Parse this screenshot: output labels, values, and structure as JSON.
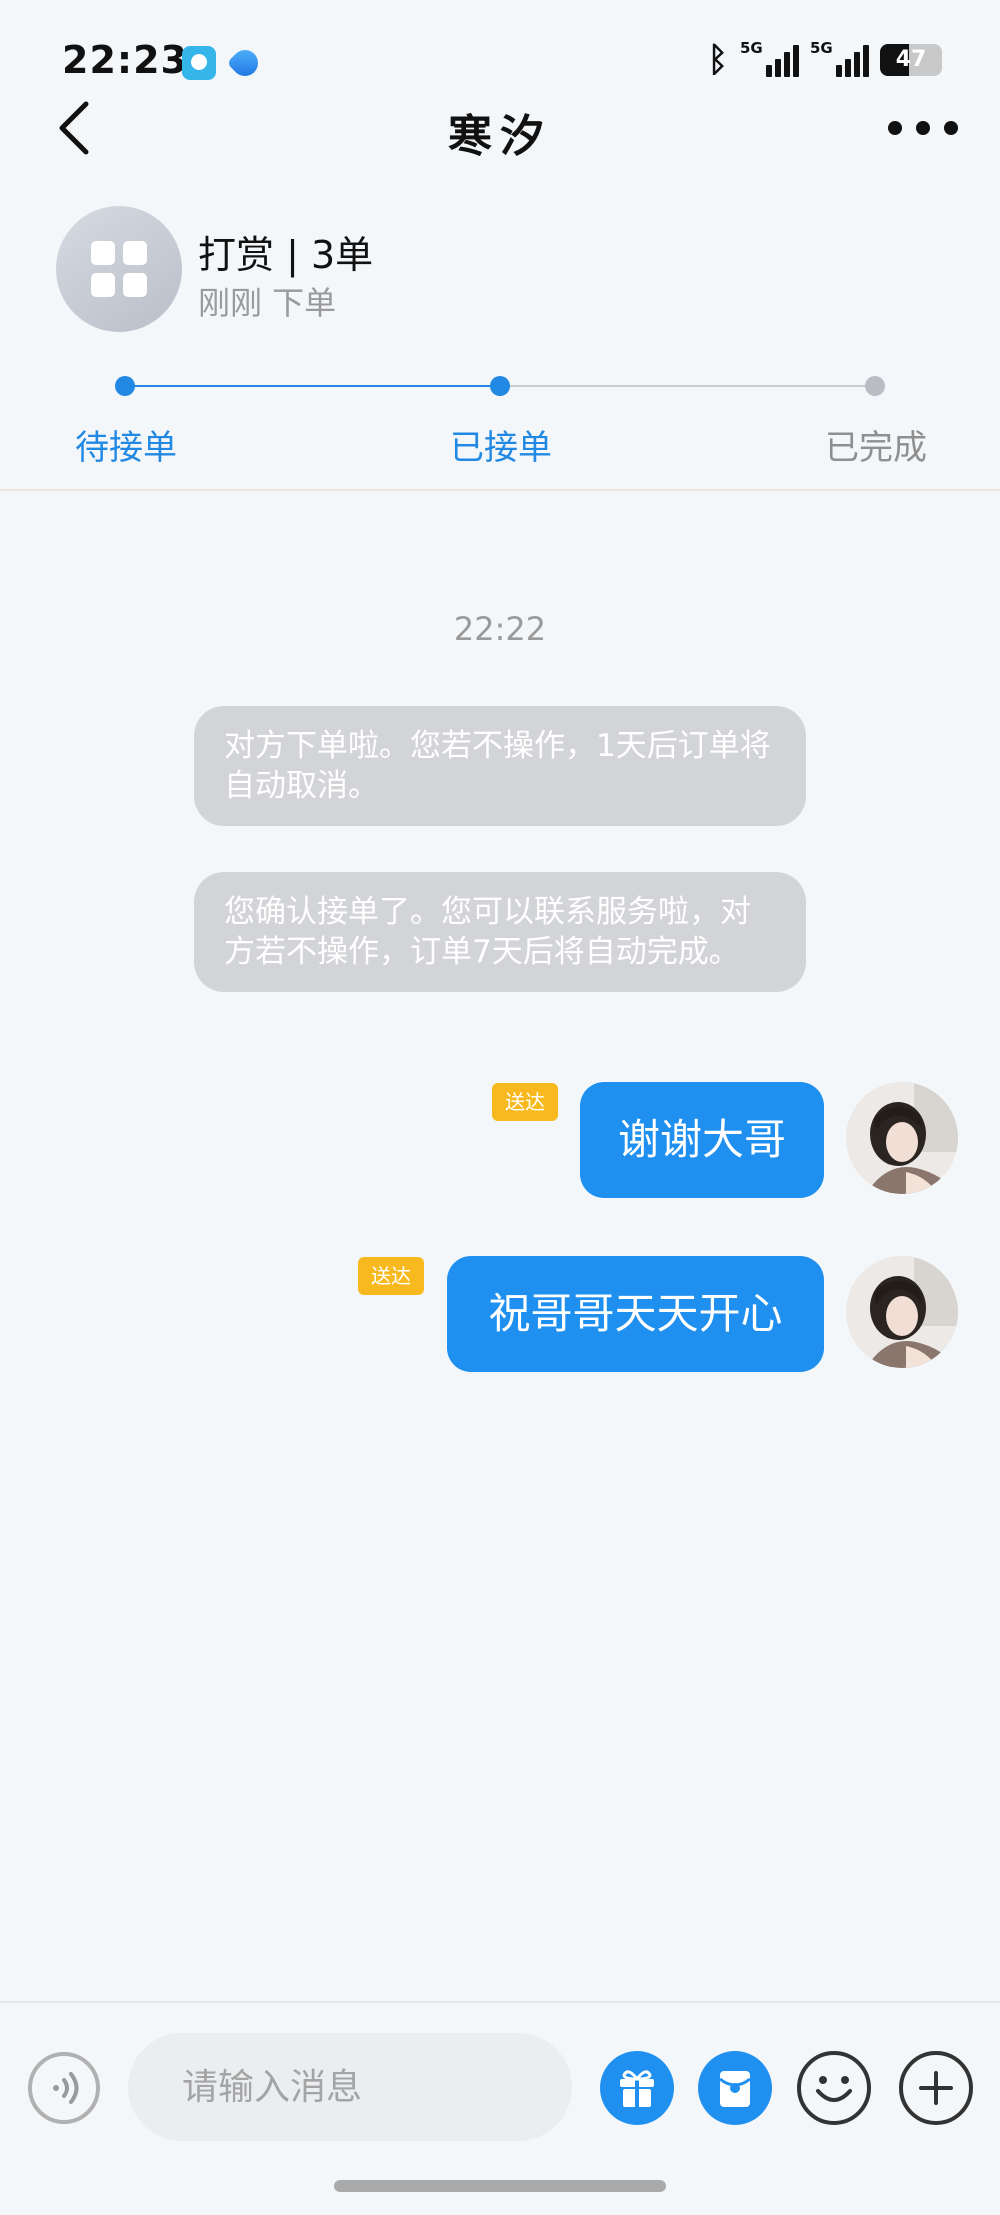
{
  "status_bar": {
    "time": "22:23",
    "network1": "5G",
    "network2": "5G",
    "battery": "47",
    "battery_level_percent": 47,
    "icons": [
      "app-icon",
      "app-icon",
      "bluetooth-icon",
      "signal-icon",
      "signal-icon",
      "battery-icon"
    ]
  },
  "nav": {
    "title": "寒汐",
    "icons": [
      "back-arrow-icon",
      "more-dots-icon"
    ]
  },
  "order": {
    "title": "打赏 | 3单",
    "subtitle": "刚刚 下单",
    "icon": "grid-apps-icon"
  },
  "progress": {
    "steps": [
      {
        "label": "待接单",
        "state": "done"
      },
      {
        "label": "已接单",
        "state": "current"
      },
      {
        "label": "已完成",
        "state": "pending"
      }
    ],
    "colors": {
      "active": "#2189e4",
      "inactive": "#b9bcc2"
    }
  },
  "chat": {
    "time": "22:22",
    "system_messages": [
      "对方下单啦。您若不操作，1天后订单将自动取消。",
      "您确认接单了。您可以联系服务啦，对方若不操作，订单7天后将自动完成。"
    ],
    "messages": [
      {
        "text": "谢谢大哥",
        "status": "送达"
      },
      {
        "text": "祝哥哥天天开心",
        "status": "送达"
      }
    ],
    "colors": {
      "bubble_out": "#1f90ef",
      "sent_tag": "#f8b91f",
      "system_bubble": "#d3d4d8"
    }
  },
  "input_bar": {
    "placeholder": "请输入消息",
    "value": "",
    "icons": [
      "voice-icon",
      "gift-icon",
      "red-packet-icon",
      "emoji-icon",
      "plus-icon"
    ],
    "colors": {
      "accent": "#1f90ef"
    }
  }
}
